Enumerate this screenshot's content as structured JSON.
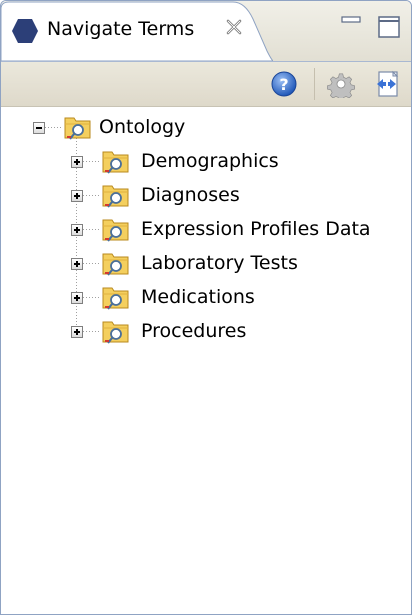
{
  "view": {
    "title": "Navigate Terms",
    "icons": {
      "tab": "hexagon-icon",
      "close": "close-icon",
      "minimize": "minimize-icon",
      "maximize": "maximize-icon"
    }
  },
  "toolbar": {
    "items": [
      {
        "icon": "help-icon"
      },
      {
        "icon": "gear-icon"
      },
      {
        "icon": "link-editor-icon"
      }
    ]
  },
  "tree": {
    "root": {
      "label": "Ontology",
      "expanded": true,
      "icon": "folder-search-icon"
    },
    "children": [
      {
        "label": "Demographics",
        "expanded": false,
        "icon": "folder-search-icon"
      },
      {
        "label": "Diagnoses",
        "expanded": false,
        "icon": "folder-search-icon"
      },
      {
        "label": "Expression Profiles Data",
        "expanded": false,
        "icon": "folder-search-icon"
      },
      {
        "label": "Laboratory Tests",
        "expanded": false,
        "icon": "folder-search-icon"
      },
      {
        "label": "Medications",
        "expanded": false,
        "icon": "folder-search-icon"
      },
      {
        "label": "Procedures",
        "expanded": false,
        "icon": "folder-search-icon"
      }
    ]
  },
  "colors": {
    "tab_icon": "#2c3f78",
    "help_blue": "#2a63c6",
    "folder_yellow": "#f4cf5e",
    "border": "#8fa3c3"
  }
}
